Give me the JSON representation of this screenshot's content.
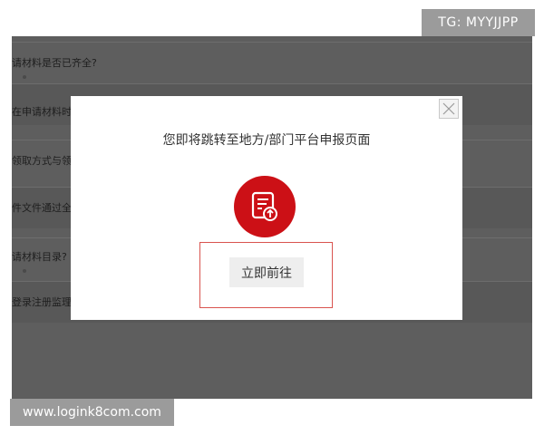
{
  "background": {
    "rows": [
      {
        "text": "请材料是否已齐全?"
      },
      {
        "text": "在申请材料时环"
      },
      {
        "text": "领取方式与领"
      },
      {
        "text": "件文件通过全国"
      },
      {
        "text": "请材料目录?"
      },
      {
        "text": "登录注册监理"
      }
    ]
  },
  "watermarks": {
    "tg": "TG: MYYJJPP",
    "site": "www.logink8com.com"
  },
  "modal": {
    "message": "您即将跳转至地方/部门平台申报页面",
    "go_button": "立即前往",
    "icon": "document-upload-icon",
    "accent_color": "#cc1016"
  }
}
